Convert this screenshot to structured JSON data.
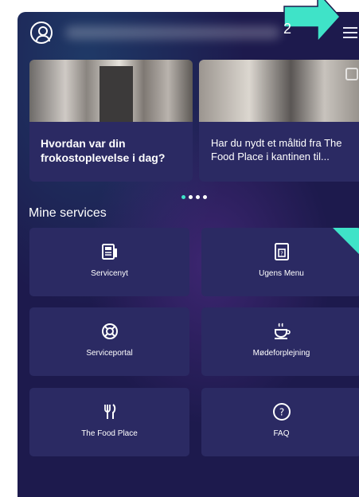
{
  "annotation": {
    "step": "2"
  },
  "carousel": {
    "cards": [
      {
        "title": "Hvordan var din frokostoplevelse i dag?"
      },
      {
        "title": "Har du nydt et måltid fra The Food Place i kantinen til..."
      }
    ],
    "active_index": 0,
    "count": 4
  },
  "services": {
    "title": "Mine services",
    "tiles": [
      {
        "label": "Servicenyt",
        "icon": "news-icon"
      },
      {
        "label": "Ugens Menu",
        "icon": "menu-book-icon",
        "highlighted": true
      },
      {
        "label": "Serviceportal",
        "icon": "lifebuoy-icon"
      },
      {
        "label": "Mødeforplejning",
        "icon": "coffee-cup-icon"
      },
      {
        "label": "The Food Place",
        "icon": "cutlery-icon"
      },
      {
        "label": "FAQ",
        "icon": "question-icon"
      }
    ]
  },
  "colors": {
    "background": "#1d1a4d",
    "tile": "#2b2a63",
    "accent": "#3fe3c8"
  }
}
